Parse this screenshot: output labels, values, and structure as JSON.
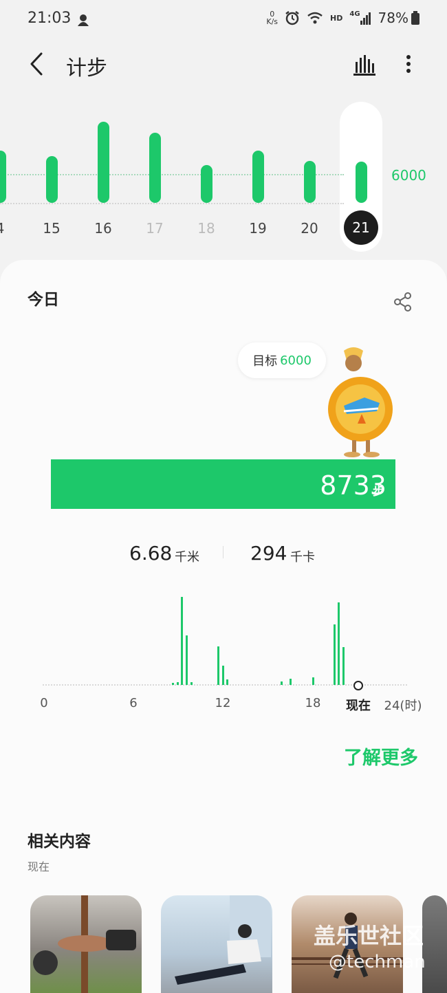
{
  "status": {
    "time": "21:03",
    "net_speed_top": "0",
    "net_speed_unit": "K/s",
    "hd": "HD",
    "net_type": "4G",
    "battery": "78%"
  },
  "header": {
    "title": "计步"
  },
  "week": {
    "goal_label": "6000",
    "days": [
      {
        "label": "4",
        "value": 6600,
        "dim": false
      },
      {
        "label": "15",
        "value": 5900,
        "dim": false
      },
      {
        "label": "16",
        "value": 10300,
        "dim": false
      },
      {
        "label": "17",
        "value": 8900,
        "dim": false
      },
      {
        "label": "18",
        "value": 4800,
        "dim": false
      },
      {
        "label": "19",
        "value": 6600,
        "dim": false
      },
      {
        "label": "20",
        "value": 5300,
        "dim": false
      },
      {
        "label": "21",
        "value": 5200,
        "dim": false
      }
    ],
    "selected": "21"
  },
  "today": {
    "title": "今日",
    "goal_prefix": "目标",
    "goal_value": "6000",
    "steps": "8733",
    "steps_unit": "步",
    "distance": "6.68",
    "distance_unit": "千米",
    "calories": "294",
    "calories_unit": "千卡"
  },
  "hourly": {
    "axis_labels": [
      "0",
      "6",
      "12",
      "18",
      "现在",
      "24(时)"
    ],
    "bars": [
      {
        "hour": 8.6,
        "value": 3
      },
      {
        "hour": 8.9,
        "value": 4
      },
      {
        "hour": 9.2,
        "value": 128
      },
      {
        "hour": 9.5,
        "value": 72
      },
      {
        "hour": 9.8,
        "value": 4
      },
      {
        "hour": 11.6,
        "value": 56
      },
      {
        "hour": 11.9,
        "value": 28
      },
      {
        "hour": 12.2,
        "value": 8
      },
      {
        "hour": 15.8,
        "value": 5
      },
      {
        "hour": 16.4,
        "value": 9
      },
      {
        "hour": 17.9,
        "value": 11
      },
      {
        "hour": 19.3,
        "value": 88
      },
      {
        "hour": 19.6,
        "value": 120
      },
      {
        "hour": 19.9,
        "value": 55
      }
    ]
  },
  "learn_more": "了解更多",
  "related": {
    "title": "相关内容",
    "subtitle": "现在"
  },
  "watermark": {
    "line1": "盖乐世社区",
    "line2": "@techman"
  },
  "colors": {
    "accent": "#1dc86a",
    "selected_circle": "#1d1d1d"
  }
}
